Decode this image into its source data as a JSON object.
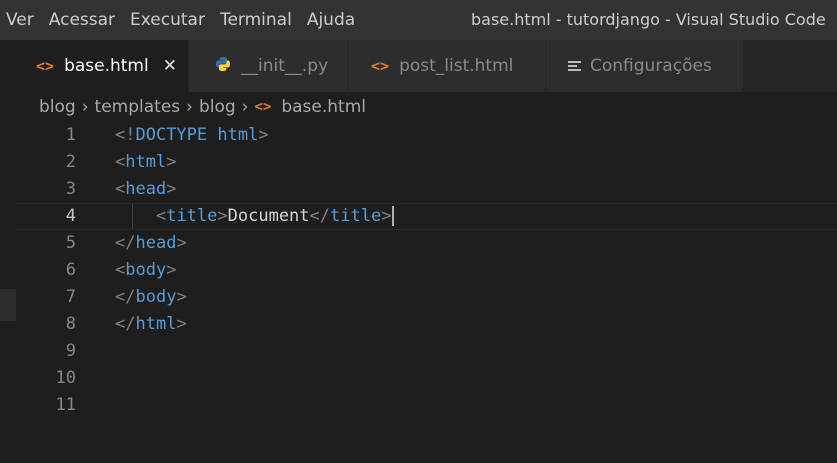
{
  "menu": [
    "Ver",
    "Acessar",
    "Executar",
    "Terminal",
    "Ajuda"
  ],
  "window_title": "base.html - tutordjango - Visual Studio Code",
  "tabs": [
    {
      "label": "base.html",
      "icon": "html-file-icon",
      "active": true
    },
    {
      "label": "__init__.py",
      "icon": "python-file-icon",
      "active": false
    },
    {
      "label": "post_list.html",
      "icon": "html-file-icon",
      "active": false
    },
    {
      "label": "Configurações",
      "icon": "settings-lines-icon",
      "active": false
    }
  ],
  "icons": {
    "html_glyph": "<>",
    "close_glyph": "✕",
    "chevron": "›"
  },
  "breadcrumb": [
    "blog",
    "templates",
    "blog",
    "base.html"
  ],
  "colors": {
    "tag": "#569cd6",
    "punctuation": "#808080",
    "text": "#d4d4d4",
    "html_icon": "#e37933",
    "python_blue": "#3572a5",
    "python_yellow": "#ffd43b"
  },
  "editor": {
    "current_line": 4,
    "lines": [
      {
        "num": "1",
        "tokens": [
          {
            "t": "<!",
            "c": "punct"
          },
          {
            "t": "DOCTYPE",
            "c": "tag"
          },
          {
            "t": " ",
            "c": "txt"
          },
          {
            "t": "html",
            "c": "kw"
          },
          {
            "t": ">",
            "c": "punct"
          }
        ]
      },
      {
        "num": "2",
        "tokens": [
          {
            "t": "<",
            "c": "punct"
          },
          {
            "t": "html",
            "c": "tag"
          },
          {
            "t": ">",
            "c": "punct"
          }
        ]
      },
      {
        "num": "3",
        "tokens": [
          {
            "t": "<",
            "c": "punct"
          },
          {
            "t": "head",
            "c": "tag"
          },
          {
            "t": ">",
            "c": "punct"
          }
        ]
      },
      {
        "num": "4",
        "tokens": [
          {
            "t": "    ",
            "c": "txt"
          },
          {
            "t": "<",
            "c": "punct"
          },
          {
            "t": "title",
            "c": "tag"
          },
          {
            "t": ">",
            "c": "punct"
          },
          {
            "t": "Document",
            "c": "txt"
          },
          {
            "t": "</",
            "c": "punct"
          },
          {
            "t": "title",
            "c": "tag"
          },
          {
            "t": ">",
            "c": "punct"
          }
        ]
      },
      {
        "num": "5",
        "tokens": [
          {
            "t": "</",
            "c": "punct"
          },
          {
            "t": "head",
            "c": "tag"
          },
          {
            "t": ">",
            "c": "punct"
          }
        ]
      },
      {
        "num": "6",
        "tokens": [
          {
            "t": "<",
            "c": "punct"
          },
          {
            "t": "body",
            "c": "tag"
          },
          {
            "t": ">",
            "c": "punct"
          }
        ]
      },
      {
        "num": "7",
        "tokens": [
          {
            "t": "</",
            "c": "punct"
          },
          {
            "t": "body",
            "c": "tag"
          },
          {
            "t": ">",
            "c": "punct"
          }
        ]
      },
      {
        "num": "8",
        "tokens": [
          {
            "t": "</",
            "c": "punct"
          },
          {
            "t": "html",
            "c": "tag"
          },
          {
            "t": ">",
            "c": "punct"
          }
        ]
      },
      {
        "num": "9",
        "tokens": []
      },
      {
        "num": "10",
        "tokens": []
      },
      {
        "num": "11",
        "tokens": []
      }
    ]
  }
}
